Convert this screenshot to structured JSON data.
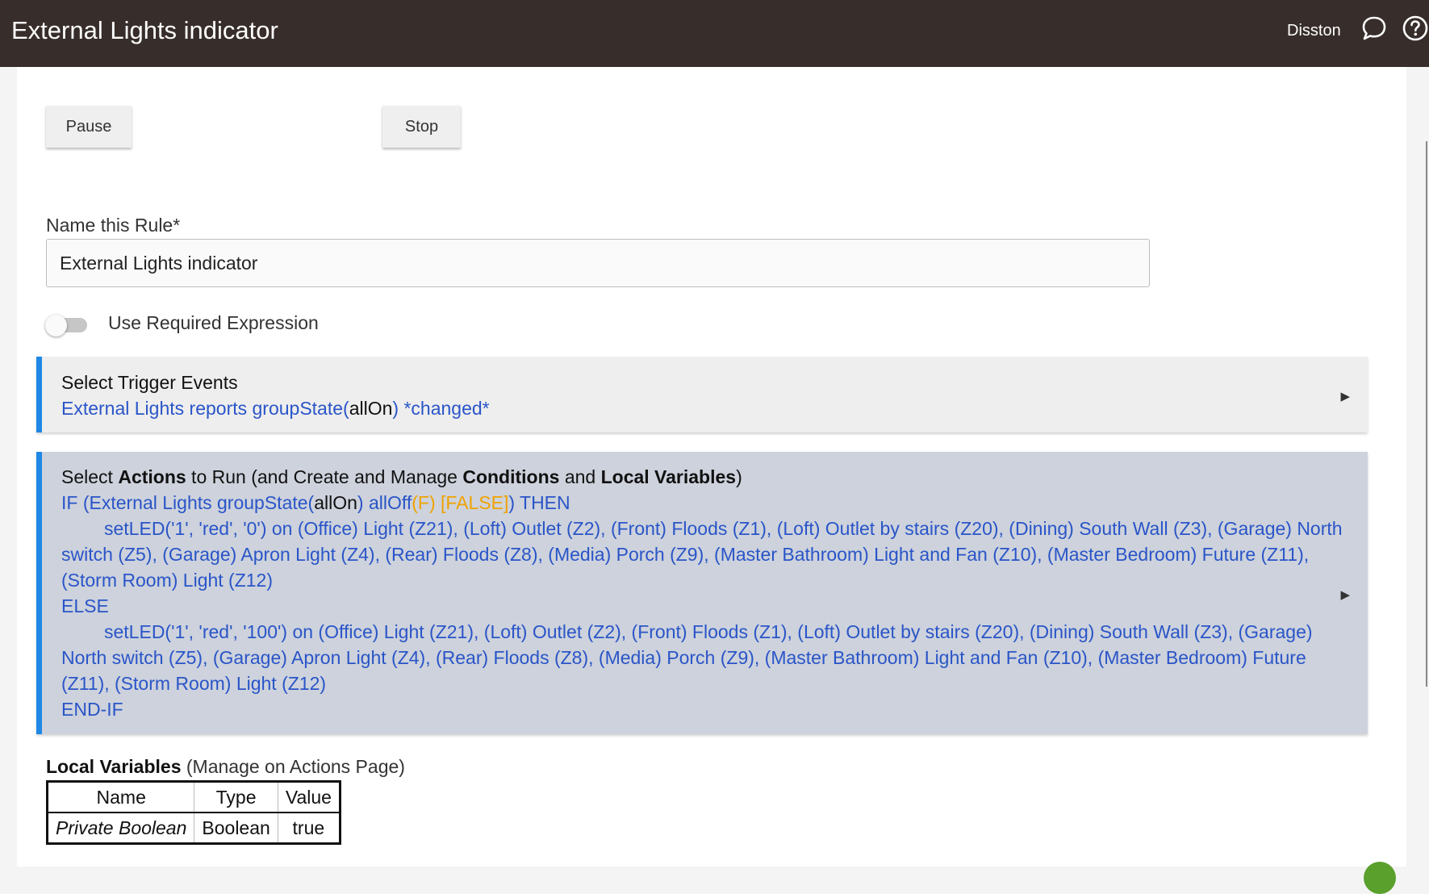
{
  "header": {
    "title": "External Lights indicator",
    "user": "Disston",
    "icons": [
      "chat-bubble-icon",
      "help-icon"
    ]
  },
  "controls": {
    "pause_label": "Pause",
    "stop_label": "Stop"
  },
  "rule_name": {
    "label": "Name this Rule*",
    "value": "External Lights indicator"
  },
  "required_expression": {
    "label": "Use Required Expression",
    "enabled": false
  },
  "trigger_section": {
    "heading": "Select Trigger Events",
    "line_prefix": "External Lights reports groupState(",
    "line_value": "allOn",
    "line_suffix": ") *changed*"
  },
  "actions_section": {
    "heading_parts": {
      "p1": "Select ",
      "b1": "Actions",
      "p2": " to Run (and Create and Manage ",
      "b2": "Conditions",
      "p3": " and ",
      "b3": "Local Variables",
      "p4": ")"
    },
    "if_line": {
      "prefix": "IF (External Lights groupState(",
      "value": "allOn",
      "mid": ") allOff",
      "flag": "(F) [FALSE]",
      "suffix": ") THEN"
    },
    "then_action": "setLED('1', 'red', '0') on (Office) Light (Z21), (Loft) Outlet (Z2), (Front) Floods (Z1), (Loft) Outlet by stairs (Z20), (Dining) South Wall (Z3), (Garage) North switch (Z5), (Garage) Apron Light (Z4), (Rear) Floods (Z8), (Media) Porch (Z9), (Master Bathroom) Light and Fan (Z10), (Master Bedroom) Future (Z11), (Storm Room) Light (Z12)",
    "else_label": "ELSE",
    "else_action": "setLED('1', 'red', '100') on (Office) Light (Z21), (Loft) Outlet (Z2), (Front) Floods (Z1), (Loft) Outlet by stairs (Z20), (Dining) South Wall (Z3), (Garage) North switch (Z5), (Garage) Apron Light (Z4), (Rear) Floods (Z8), (Media) Porch (Z9), (Master Bathroom) Light and Fan (Z10), (Master Bedroom) Future (Z11), (Storm Room) Light (Z12)",
    "end_label": "END-IF"
  },
  "local_variables": {
    "title_bold": "Local Variables",
    "title_rest": " (Manage on Actions Page)",
    "columns": [
      "Name",
      "Type",
      "Value"
    ],
    "rows": [
      {
        "name": "Private Boolean",
        "type": "Boolean",
        "value": "true"
      }
    ]
  },
  "colors": {
    "topbar": "#372d2a",
    "accent": "#1e88e5",
    "link_text": "#2a55c8",
    "false_flag": "#f0a300"
  }
}
